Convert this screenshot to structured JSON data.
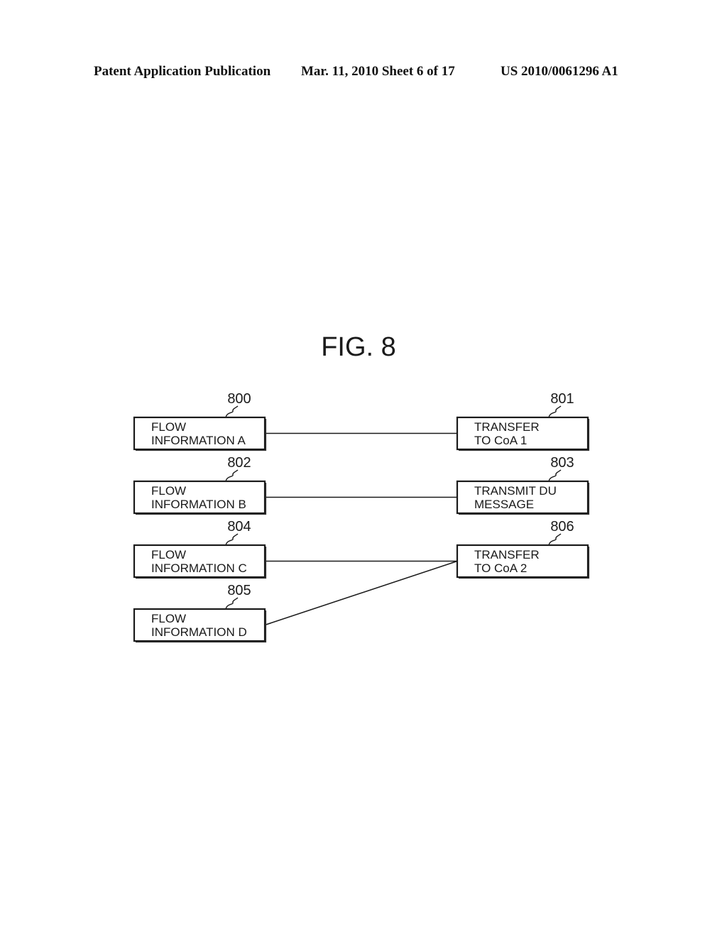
{
  "header": {
    "publication": "Patent Application Publication",
    "date_sheet": "Mar. 11, 2010  Sheet 6 of 17",
    "patent_number": "US 2010/0061296 A1"
  },
  "figure": {
    "title": "FIG. 8",
    "boxes": [
      {
        "id": "800",
        "ref": "800",
        "lines": [
          "FLOW",
          "INFORMATION A"
        ],
        "column": "left",
        "row": 0
      },
      {
        "id": "801",
        "ref": "801",
        "lines": [
          "TRANSFER",
          "TO CoA 1"
        ],
        "column": "right",
        "row": 0
      },
      {
        "id": "802",
        "ref": "802",
        "lines": [
          "FLOW",
          "INFORMATION B"
        ],
        "column": "left",
        "row": 1
      },
      {
        "id": "803",
        "ref": "803",
        "lines": [
          "TRANSMIT DU",
          "MESSAGE"
        ],
        "column": "right",
        "row": 1
      },
      {
        "id": "804",
        "ref": "804",
        "lines": [
          "FLOW",
          "INFORMATION C"
        ],
        "column": "left",
        "row": 2
      },
      {
        "id": "806",
        "ref": "806",
        "lines": [
          "TRANSFER",
          "TO CoA 2"
        ],
        "column": "right",
        "row": 2
      },
      {
        "id": "805",
        "ref": "805",
        "lines": [
          "FLOW",
          "INFORMATION D"
        ],
        "column": "left",
        "row": 3
      }
    ],
    "connections": [
      {
        "from": "800",
        "to": "801"
      },
      {
        "from": "802",
        "to": "803"
      },
      {
        "from": "804",
        "to": "806"
      },
      {
        "from": "805",
        "to": "806"
      }
    ]
  }
}
